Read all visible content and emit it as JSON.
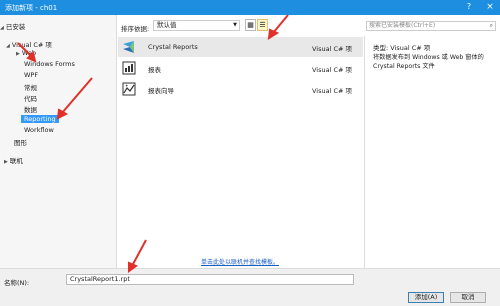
{
  "window": {
    "title": "添加新项 - ch01",
    "help_label": "?",
    "close_label": "×"
  },
  "sidebar": {
    "installed_label": "已安装",
    "items": [
      {
        "label": "Visual C# 项",
        "expand": "◢"
      },
      {
        "label": "Web",
        "expand": "▶"
      },
      {
        "label": "Windows Forms",
        "expand": ""
      },
      {
        "label": "WPF",
        "expand": ""
      },
      {
        "label": "常规",
        "expand": ""
      },
      {
        "label": "代码",
        "expand": ""
      },
      {
        "label": "数据",
        "expand": ""
      },
      {
        "label": "Reporting",
        "expand": ""
      },
      {
        "label": "Workflow",
        "expand": ""
      },
      {
        "label": "图形",
        "expand": ""
      },
      {
        "label": "联机",
        "expand": "▶"
      }
    ]
  },
  "toolbar": {
    "sort_label": "排序依据:",
    "sort_value": "默认值",
    "grid_view": "▦",
    "list_view": "☰"
  },
  "search": {
    "placeholder": "搜索已安装模板(Ctrl+E)",
    "icon": "search-icon"
  },
  "templates": [
    {
      "name": "Crystal Reports",
      "lang": "Visual C# 项",
      "icon": "crystal-reports-icon"
    },
    {
      "name": "报表",
      "lang": "Visual C# 项",
      "icon": "report-icon"
    },
    {
      "name": "报表向导",
      "lang": "Visual C# 项",
      "icon": "report-wizard-icon"
    }
  ],
  "online_link": "单击此处以联机并查找模板。",
  "details": {
    "type_label": "类型:",
    "type_value": "Visual C# 项",
    "description": "将数据发布到 Windows 或 Web 窗体的 Crystal Reports 文件"
  },
  "footer": {
    "name_label": "名称(N):",
    "name_value": "CrystalReport1.rpt",
    "add_label": "添加(A)",
    "cancel_label": "取消"
  },
  "colors": {
    "accent": "#1e8fe0",
    "selection": "#3399ff",
    "annotation_arrow": "#e0302a"
  }
}
